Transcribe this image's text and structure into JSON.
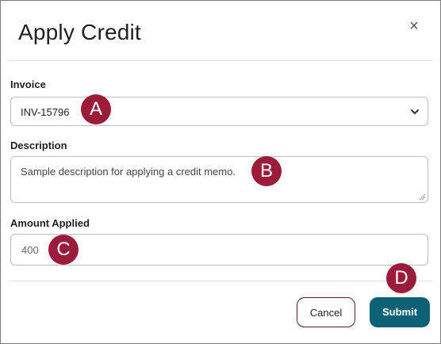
{
  "dialog": {
    "title": "Apply Credit",
    "close_glyph": "×"
  },
  "invoice": {
    "label": "Invoice",
    "selected": "INV-15796"
  },
  "description": {
    "label": "Description",
    "value": "Sample description for applying a credit memo."
  },
  "amount": {
    "label": "Amount Applied",
    "value": "400"
  },
  "buttons": {
    "cancel": "Cancel",
    "submit": "Submit"
  },
  "callouts": {
    "a": "A",
    "b": "B",
    "c": "C",
    "d": "D",
    "color": "#9b1b3a"
  },
  "colors": {
    "submit_bg": "#0d6176",
    "border": "#bdbdbd"
  }
}
